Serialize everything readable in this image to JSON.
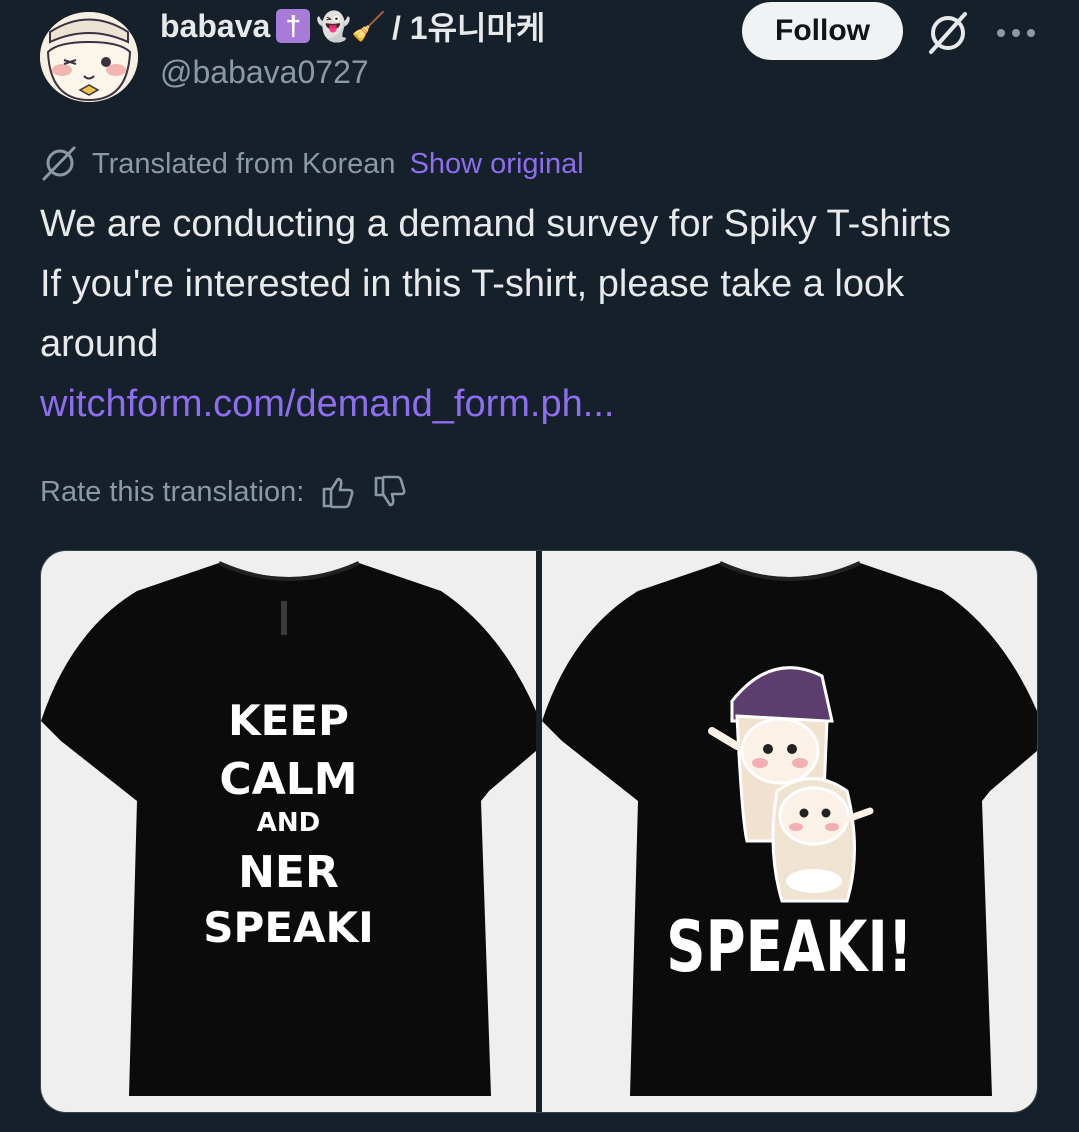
{
  "author": {
    "display_name": "babava",
    "badge_glyph": "†",
    "emojis": "👻🧹",
    "name_suffix": "/ 1유니마케",
    "handle": "@babava0727"
  },
  "actions": {
    "follow_label": "Follow"
  },
  "translation": {
    "label": "Translated from Korean",
    "show_original": "Show original",
    "rate_label": "Rate this translation:"
  },
  "post": {
    "line1": "We are conducting a demand survey for Spiky T-shirts",
    "line2": "If you're interested in this T-shirt, please take a look",
    "line3": "around",
    "link_text": "witchform.com/demand_form.ph..."
  },
  "media": {
    "shirt1_lines": [
      "KEEP",
      "CALM",
      "AND",
      "NER",
      "SPEAKI"
    ],
    "shirt2_text": "SPEAKI!"
  },
  "colors": {
    "background": "#15202b",
    "accent_link": "#8d6df0",
    "muted_text": "#8b98a5",
    "badge_purple": "#a97bd8"
  },
  "icons": [
    "grok-icon",
    "more-options-icon",
    "translate-icon",
    "thumbs-up-icon",
    "thumbs-down-icon"
  ]
}
